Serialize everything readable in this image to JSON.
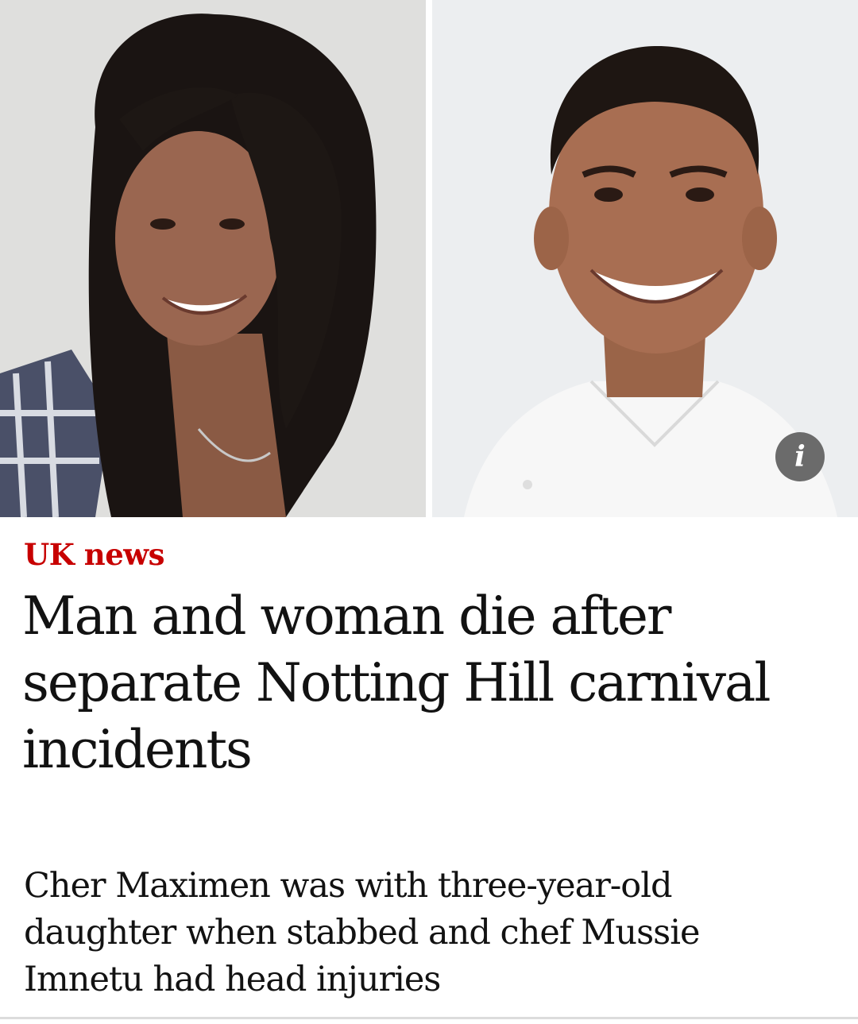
{
  "article": {
    "kicker": "UK news",
    "headline": "Man and woman die after separate Notting Hill carnival incidents",
    "standfirst": "Cher Maximen was with three-year-old daughter when stabbed and chef Mussie Imnetu had head injuries"
  },
  "image": {
    "info_button_label": "i"
  },
  "colors": {
    "kicker": "#c70000",
    "text": "#121212",
    "info_button": "#6b6b6b"
  }
}
